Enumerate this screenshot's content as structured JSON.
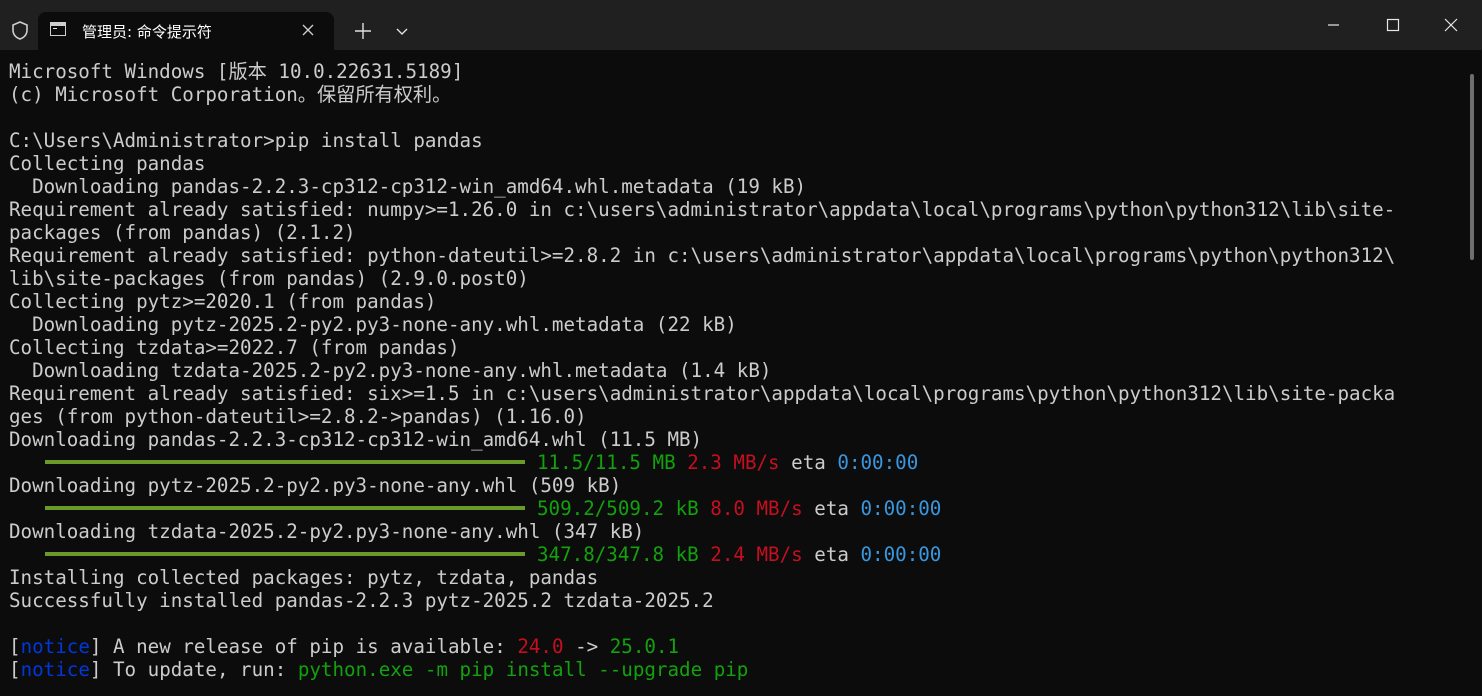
{
  "titlebar": {
    "tab_title": "管理员: 命令提示符",
    "icons": {
      "shield": "shield-icon",
      "tab": "cmd-icon",
      "close_tab": "close-icon",
      "new_tab": "plus-icon",
      "dropdown": "chevron-down-icon",
      "minimize": "minimize-icon",
      "maximize": "maximize-icon",
      "close_window": "close-icon"
    }
  },
  "colors": {
    "background": "#0c0c0c",
    "text": "#cccccc",
    "green": "#13a10e",
    "red": "#c50f1f",
    "cyan": "#3a96dd",
    "blue": "#0037da",
    "progress": "#6a9a2a"
  },
  "terminal": {
    "l1": "Microsoft Windows [版本 10.0.22631.5189]",
    "l2": "(c) Microsoft Corporation。保留所有权利。",
    "l3": "C:\\Users\\Administrator>pip install pandas",
    "l4": "Collecting pandas",
    "l5": "  Downloading pandas-2.2.3-cp312-cp312-win_amd64.whl.metadata (19 kB)",
    "l6": "Requirement already satisfied: numpy>=1.26.0 in c:\\users\\administrator\\appdata\\local\\programs\\python\\python312\\lib\\site-",
    "l7": "packages (from pandas) (2.1.2)",
    "l8": "Requirement already satisfied: python-dateutil>=2.8.2 in c:\\users\\administrator\\appdata\\local\\programs\\python\\python312\\",
    "l9": "lib\\site-packages (from pandas) (2.9.0.post0)",
    "l10": "Collecting pytz>=2020.1 (from pandas)",
    "l11": "  Downloading pytz-2025.2-py2.py3-none-any.whl.metadata (22 kB)",
    "l12": "Collecting tzdata>=2022.7 (from pandas)",
    "l13": "  Downloading tzdata-2025.2-py2.py3-none-any.whl.metadata (1.4 kB)",
    "l14": "Requirement already satisfied: six>=1.5 in c:\\users\\administrator\\appdata\\local\\programs\\python\\python312\\lib\\site-packa",
    "l15": "ges (from python-dateutil>=2.8.2->pandas) (1.16.0)",
    "l16": "Downloading pandas-2.2.3-cp312-cp312-win_amd64.whl (11.5 MB)",
    "p1": {
      "progress": 1.0,
      "size": "11.5/11.5 MB",
      "speed": "2.3 MB/s",
      "eta_label": "eta",
      "eta": "0:00:00"
    },
    "l18": "Downloading pytz-2025.2-py2.py3-none-any.whl (509 kB)",
    "p2": {
      "progress": 1.0,
      "size": "509.2/509.2 kB",
      "speed": "8.0 MB/s",
      "eta_label": "eta",
      "eta": "0:00:00"
    },
    "l20": "Downloading tzdata-2025.2-py2.py3-none-any.whl (347 kB)",
    "p3": {
      "progress": 1.0,
      "size": "347.8/347.8 kB",
      "speed": "2.4 MB/s",
      "eta_label": "eta",
      "eta": "0:00:00"
    },
    "l22": "Installing collected packages: pytz, tzdata, pandas",
    "l23": "Successfully installed pandas-2.2.3 pytz-2025.2 tzdata-2025.2",
    "n1": {
      "open": "[",
      "tag": "notice",
      "close": "]",
      "text": " A new release of pip is available: ",
      "old": "24.0",
      "arrow": " -> ",
      "new": "25.0.1"
    },
    "n2": {
      "open": "[",
      "tag": "notice",
      "close": "]",
      "text": " To update, run: ",
      "cmd": "python.exe -m pip install --upgrade pip"
    }
  }
}
